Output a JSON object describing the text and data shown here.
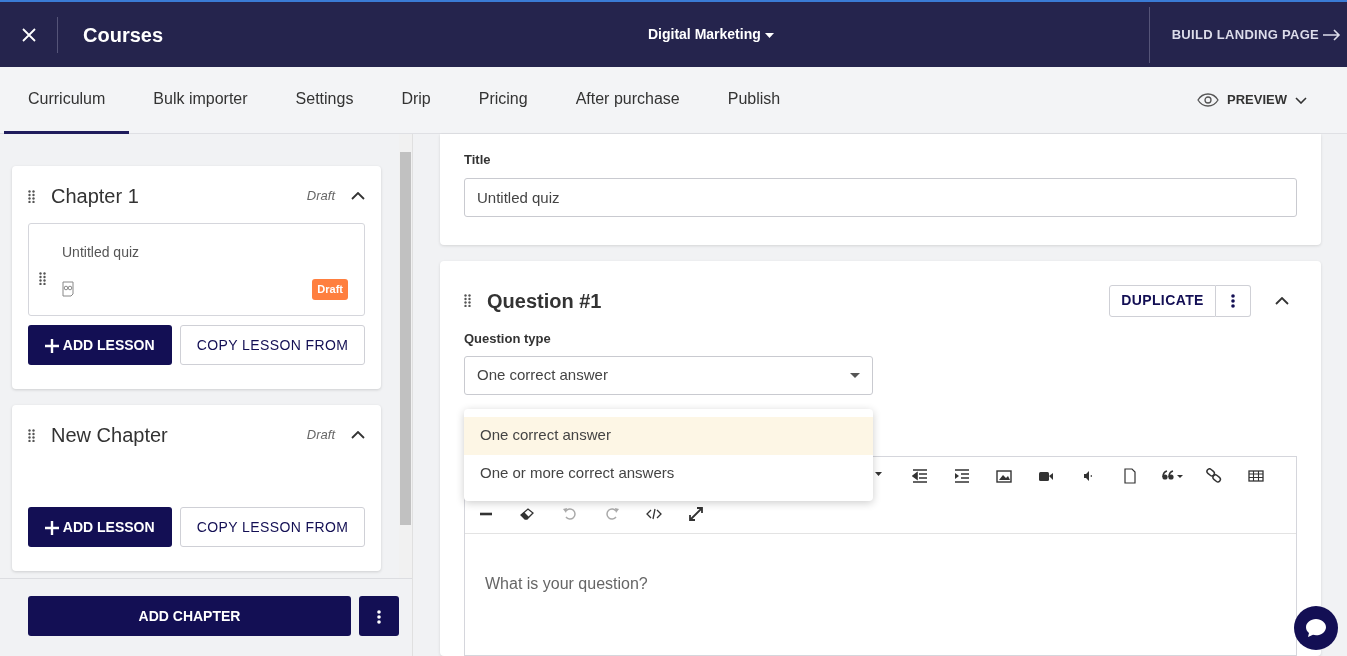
{
  "header": {
    "title": "Courses",
    "course_selector": "Digital Marketing",
    "build_button": "BUILD LANDING PAGE"
  },
  "tabs": [
    {
      "label": "Curriculum",
      "selected": true
    },
    {
      "label": "Bulk importer",
      "selected": false
    },
    {
      "label": "Settings",
      "selected": false
    },
    {
      "label": "Drip",
      "selected": false
    },
    {
      "label": "Pricing",
      "selected": false
    },
    {
      "label": "After purchase",
      "selected": false
    },
    {
      "label": "Publish",
      "selected": false
    }
  ],
  "preview_button": "PREVIEW",
  "chapters": [
    {
      "title": "Chapter 1",
      "status": "Draft",
      "expanded": true,
      "lessons": [
        {
          "title": "Untitled quiz",
          "status": "Draft"
        }
      ],
      "add_lesson": "ADD LESSON",
      "copy_lesson": "COPY LESSON FROM"
    },
    {
      "title": "New Chapter",
      "status": "Draft",
      "expanded": true,
      "add_lesson": "ADD LESSON",
      "copy_lesson": "COPY LESSON FROM"
    }
  ],
  "add_chapter": "ADD CHAPTER",
  "title_card": {
    "label": "Title",
    "value": "Untitled quiz"
  },
  "question": {
    "heading": "Question #1",
    "duplicate": "DUPLICATE",
    "expanded": true,
    "type_label": "Question type",
    "type_value": "One correct answer",
    "dropdown_open": true,
    "type_options": [
      {
        "label": "One correct answer",
        "selected": true
      },
      {
        "label": "One or more correct answers",
        "selected": false
      }
    ],
    "editor_placeholder": "What is your question?"
  }
}
